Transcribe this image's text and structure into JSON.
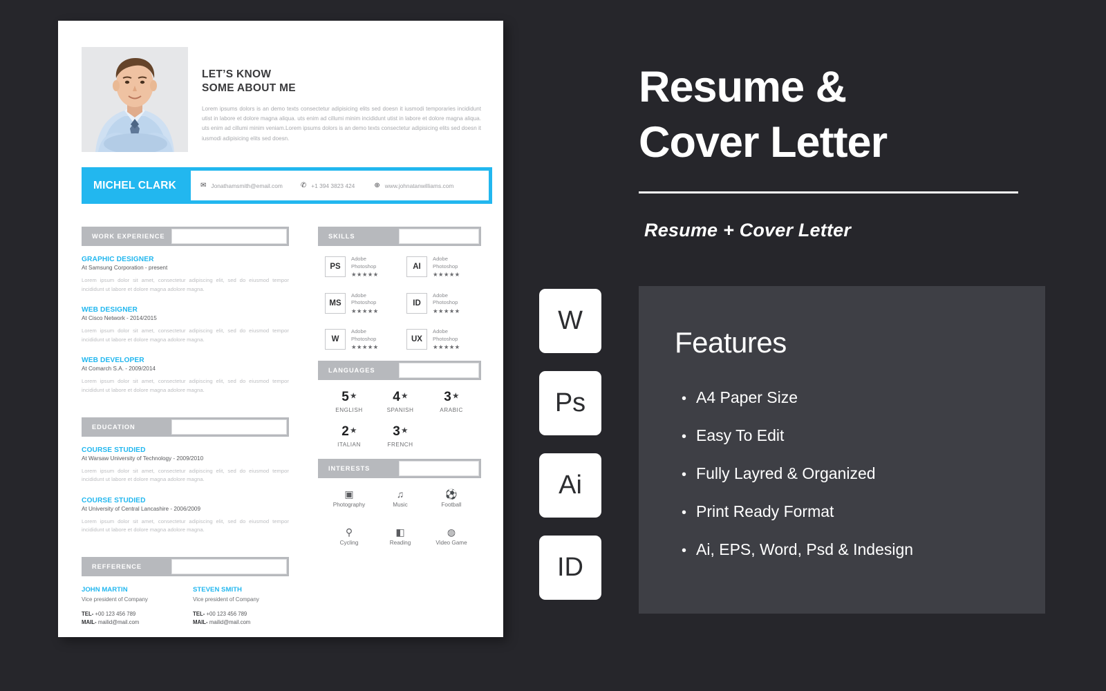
{
  "resume": {
    "about": {
      "title_line1": "LET’S KNOW",
      "title_line2": "SOME ABOUT ME",
      "body": "Lorem ipsums dolors is an demo texts consectetur adipisicing elits sed doesn it iusmodi temporaries incididunt utist in labore et dolore magna aliqua. uts enim ad cillumi minim incididunt utist in labore et dolore magna aliqua. uts enim ad cillumi minim veniam.Lorem ipsums dolors is an demo texts consectetur adipisicing elits sed doesn it iusmodi adipisicing elits sed doesn."
    },
    "name": "MICHEL CLARK",
    "contacts": [
      {
        "icon": "mail-icon",
        "glyph": "✉",
        "text": "Jonathamsmith@email.com"
      },
      {
        "icon": "phone-icon",
        "glyph": "✆",
        "text": "+1 394 3823 424"
      },
      {
        "icon": "globe-icon",
        "glyph": "⊕",
        "text": "www.johnatanwilliams.com"
      }
    ],
    "sections": {
      "work": "WORK EXPERIENCE",
      "education": "EDUCATION",
      "reference": "REFFERENCE",
      "skills": "SKILLS",
      "languages": "LANGUAGES",
      "interests": "INTERESTS"
    },
    "work_entries": [
      {
        "title": "GRAPHIC DESIGNER",
        "sub": "At Samsung Corporation - present",
        "desc": "Lorem ipsum dolor sit amet, consectetur adipiscing elit, sed do eiusmod tempor incididunt ut labore et dolore magna adolore magna."
      },
      {
        "title": "WEB DESIGNER",
        "sub": "At Cisco Network - 2014/2015",
        "desc": "Lorem ipsum dolor sit amet, consectetur adipiscing elit, sed do eiusmod tempor incididunt ut labore et dolore magna adolore magna."
      },
      {
        "title": "WEB DEVELOPER",
        "sub": "At Comarch S.A. - 2009/2014",
        "desc": "Lorem ipsum dolor sit amet, consectetur adipiscing elit, sed do eiusmod tempor incididunt ut labore et dolore magna adolore magna."
      }
    ],
    "education_entries": [
      {
        "title": "COURSE STUDIED",
        "sub": "At Warsaw University of Technology - 2009/2010",
        "desc": "Lorem ipsum dolor sit amet, consectetur adipiscing elit, sed do eiusmod tempor incididunt ut labore et dolore magna adolore magna."
      },
      {
        "title": "COURSE STUDIED",
        "sub": "At University of Central Lancashire - 2006/2009",
        "desc": "Lorem ipsum dolor sit amet, consectetur adipiscing elit, sed do eiusmod tempor incididunt ut labore et dolore magna adolore magna."
      }
    ],
    "references": [
      {
        "name": "JOHN MARTIN",
        "role": "Vice president of Company",
        "tel_label": "TEL-",
        "tel": "+00 123 456 789",
        "mail_label": "MAIL-",
        "mail": "mailid@mail.com"
      },
      {
        "name": "STEVEN SMITH",
        "role": "Vice president of Company",
        "tel_label": "TEL-",
        "tel": "+00 123 456 789",
        "mail_label": "MAIL-",
        "mail": "mailid@mail.com"
      }
    ],
    "skills": [
      {
        "code": "PS",
        "line1": "Adobe",
        "line2": "Photoshop",
        "stars": "★★★★★"
      },
      {
        "code": "AI",
        "line1": "Adobe",
        "line2": "Photoshop",
        "stars": "★★★★★"
      },
      {
        "code": "MS",
        "line1": "Adobe",
        "line2": "Photoshop",
        "stars": "★★★★★"
      },
      {
        "code": "ID",
        "line1": "Adobe",
        "line2": "Photoshop",
        "stars": "★★★★★"
      },
      {
        "code": "W",
        "line1": "Adobe",
        "line2": "Photoshop",
        "stars": "★★★★★"
      },
      {
        "code": "UX",
        "line1": "Adobe",
        "line2": "Photoshop",
        "stars": "★★★★★"
      }
    ],
    "languages": [
      {
        "level": "5",
        "star": "★",
        "label": "ENGLISH"
      },
      {
        "level": "4",
        "star": "★",
        "label": "SPANISH"
      },
      {
        "level": "3",
        "star": "★",
        "label": "ARABIC"
      },
      {
        "level": "2",
        "star": "★",
        "label": "ITALIAN"
      },
      {
        "level": "3",
        "star": "★",
        "label": "FRENCH"
      }
    ],
    "interests": [
      {
        "icon": "camera-icon",
        "glyph": "▣",
        "label": "Photography"
      },
      {
        "icon": "music-note-icon",
        "glyph": "♫",
        "label": "Music"
      },
      {
        "icon": "football-icon",
        "glyph": "⚽",
        "label": "Football"
      },
      {
        "icon": "bicycle-icon",
        "glyph": "⚲",
        "label": "Cycling"
      },
      {
        "icon": "book-icon",
        "glyph": "◧",
        "label": "Reading"
      },
      {
        "icon": "gamepad-icon",
        "glyph": "◍",
        "label": "Video Game"
      }
    ]
  },
  "promo": {
    "title_line1": "Resume &",
    "title_line2": "Cover  Letter",
    "subtitle": "Resume + Cover Letter",
    "app_badges": [
      {
        "code": "W",
        "name": "word-badge"
      },
      {
        "code": "Ps",
        "name": "photoshop-badge"
      },
      {
        "code": "Ai",
        "name": "illustrator-badge"
      },
      {
        "code": "ID",
        "name": "indesign-badge"
      }
    ],
    "features_title": "Features",
    "features": [
      "A4 Paper Size",
      "Easy To Edit",
      "Fully Layred & Organized",
      "Print Ready Format",
      "Ai, EPS, Word, Psd & Indesign"
    ]
  },
  "colors": {
    "background": "#26262b",
    "accent": "#22b7ef",
    "panel": "#3e3f45",
    "section_bar": "#b7b9bd"
  }
}
